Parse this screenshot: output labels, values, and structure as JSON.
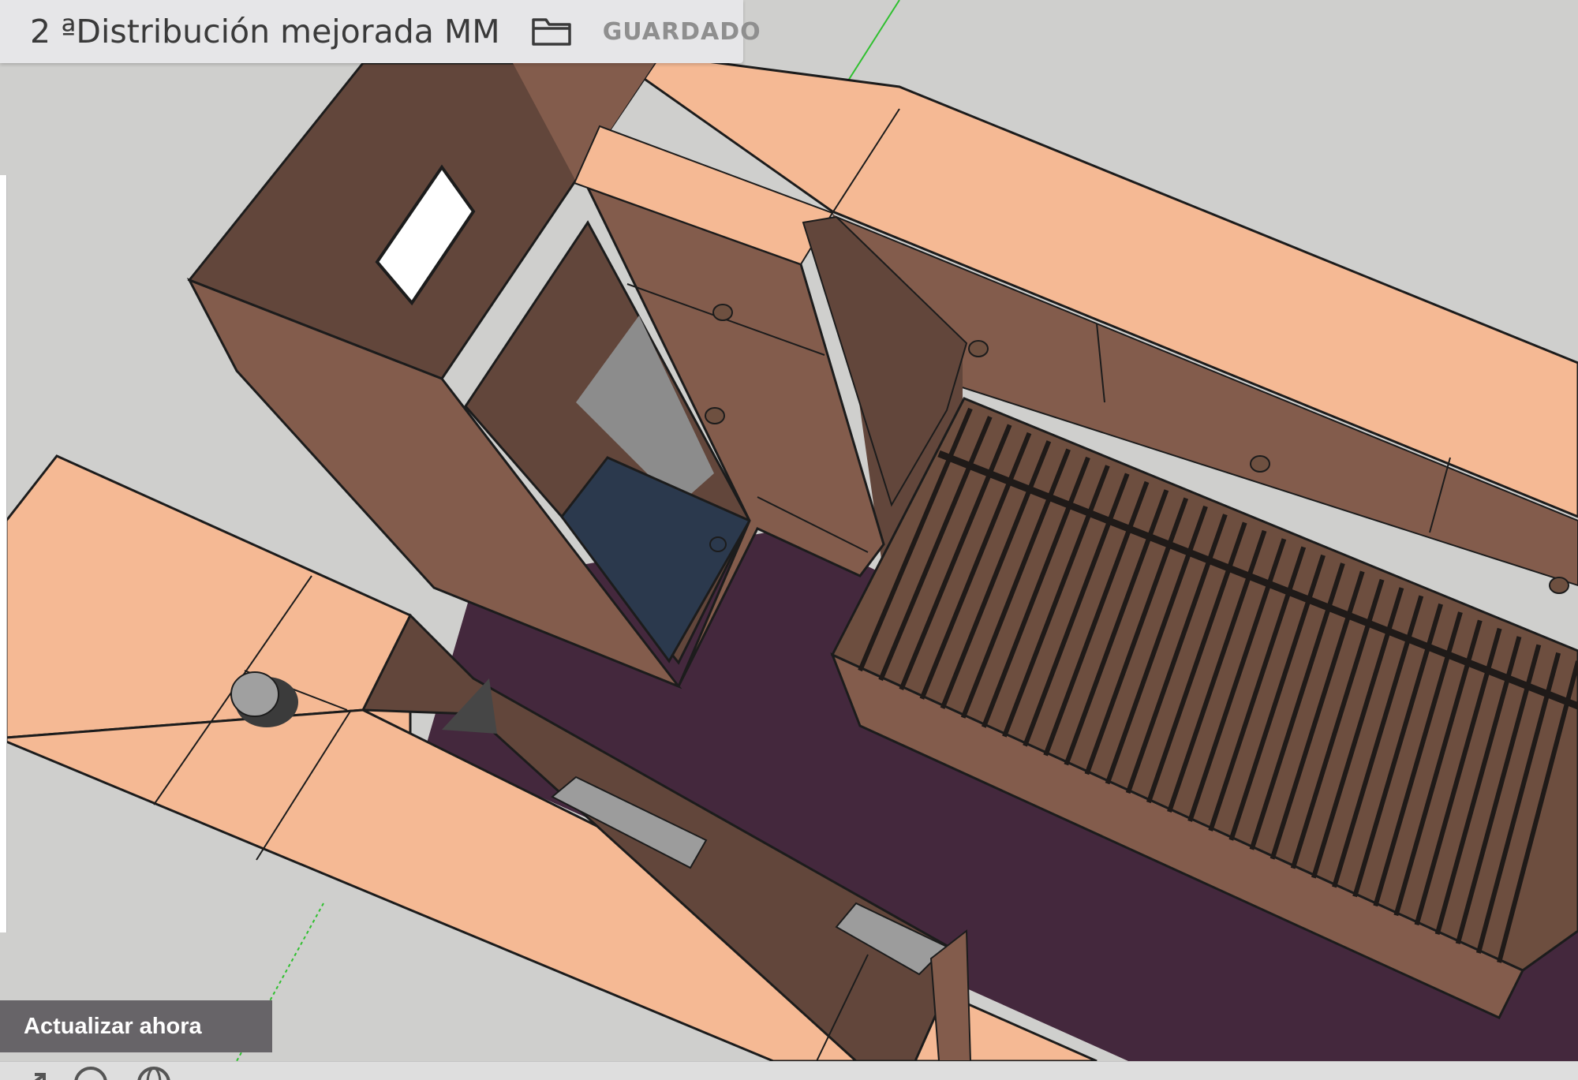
{
  "app": {
    "document_title": "2 ªDistribución mejorada MM",
    "save_status": "GUARDADO",
    "update_button_label": "Actualizar ahora"
  },
  "icons": {
    "folder": "folder-icon",
    "status_left": [
      "arrow-icon",
      "circle-question-icon",
      "globe-icon"
    ]
  },
  "colors": {
    "background": "#cfcfcd",
    "top_surface": "#f5b994",
    "wood_side": "#835c4c",
    "wood_dark": "#62463b",
    "floor": "#44283d",
    "shower_tray": "#2b394d",
    "axis_green": "#2fc02f"
  }
}
